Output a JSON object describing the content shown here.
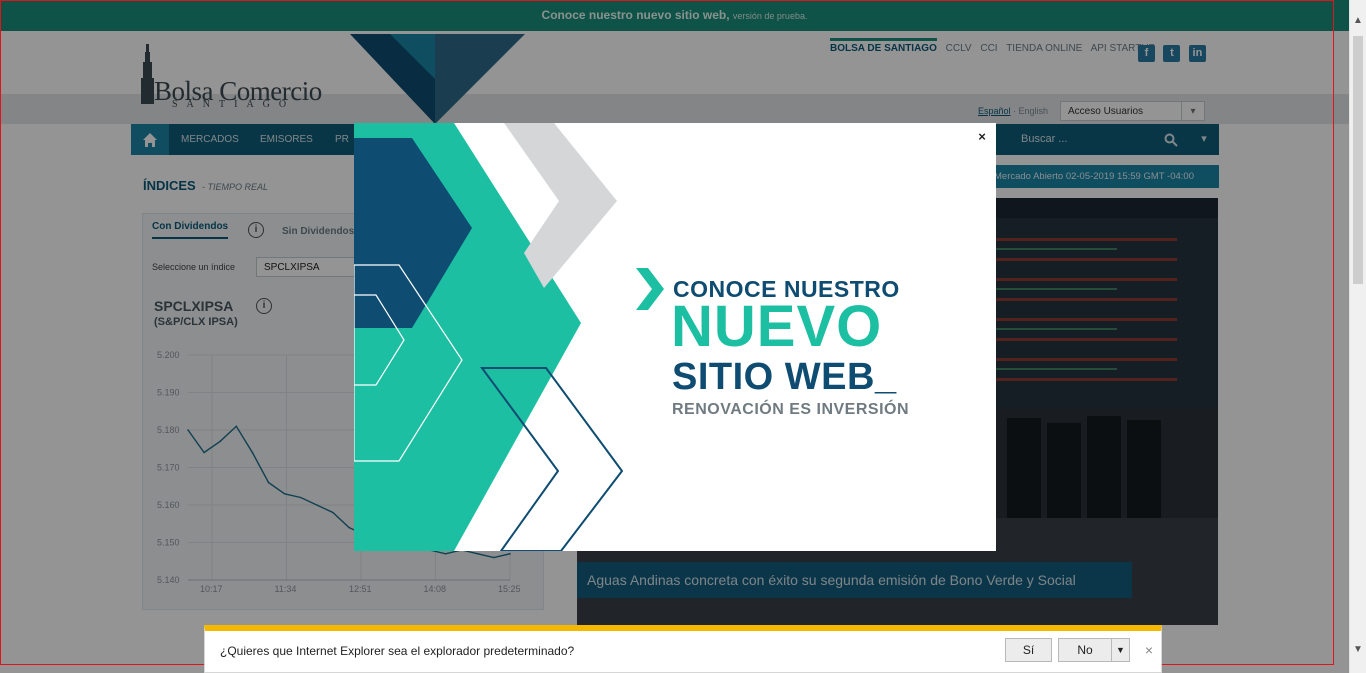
{
  "banner": {
    "bold": "Conoce nuestro nuevo sitio web,",
    "small": "versión de prueba."
  },
  "logo": {
    "name": "Bolsa Comercio",
    "sub": "SANTIAGO"
  },
  "toplinks": [
    "BOLSA DE SANTIAGO",
    "CCLV",
    "CCI",
    "TIENDA ONLINE",
    "API STARTUP"
  ],
  "social": [
    "f",
    "t",
    "in"
  ],
  "lang": {
    "current": "Español",
    "other": "English"
  },
  "user_select": "Acceso Usuarios",
  "nav": {
    "items": [
      "MERCADOS",
      "EMISORES",
      "PR"
    ],
    "search_placeholder": "Buscar ..."
  },
  "indices": {
    "title": "ÍNDICES",
    "subtitle": "- TIEMPO REAL",
    "tab_with": "Con Dividendos",
    "tab_without": "Sin Dividendos",
    "select_label": "Seleccione un índice",
    "select_value": "SPCLXIPSA",
    "chart_title": "SPCLXIPSA",
    "chart_subtitle": "(S&P/CLX IPSA)"
  },
  "chart_data": {
    "type": "line",
    "title": "SPCLXIPSA",
    "subtitle": "(S&P/CLX IPSA)",
    "y_ticks": [
      "5.200",
      "5.190",
      "5.180",
      "5.170",
      "5.160",
      "5.150",
      "5.140"
    ],
    "x_ticks": [
      "10:17",
      "11:34",
      "12:51",
      "14:08",
      "15:25"
    ],
    "ylim": [
      5140,
      5200
    ],
    "x": [
      "10:17",
      "10:30",
      "10:45",
      "11:00",
      "11:15",
      "11:34",
      "11:50",
      "12:05",
      "12:20",
      "12:35",
      "12:51",
      "13:05",
      "13:20",
      "13:35",
      "13:50",
      "14:08",
      "14:25",
      "14:40",
      "14:55",
      "15:10",
      "15:25"
    ],
    "values": [
      5180,
      5174,
      5177,
      5181,
      5174,
      5166,
      5163,
      5162,
      5160,
      5158,
      5154,
      5152,
      5153,
      5151,
      5149,
      5148,
      5147,
      5148,
      5147,
      5146,
      5147
    ]
  },
  "status_strip": "Mercado Abierto 02-05-2019 15:59 GMT -04:00",
  "photo_caption": "Aguas Andinas concreta con éxito su segunda emisión de Bono Verde y Social",
  "modal": {
    "close": "×",
    "line1": "CONOCE NUESTRO",
    "line2": "NUEVO",
    "line3": "SITIO WEB_",
    "line4": "RENOVACIÓN ES INVERSIÓN"
  },
  "iebar": {
    "message": "¿Quieres que Internet Explorer sea el explorador predeterminado?",
    "yes": "Sí",
    "no": "No",
    "close": "×"
  },
  "colors": {
    "teal": "#1dbfa3",
    "navy": "#0f4c72",
    "nav_bg": "#0f5e79",
    "banner_bg": "#1b8e7c",
    "ie_accent": "#f5b800",
    "frame": "#e0141b"
  }
}
